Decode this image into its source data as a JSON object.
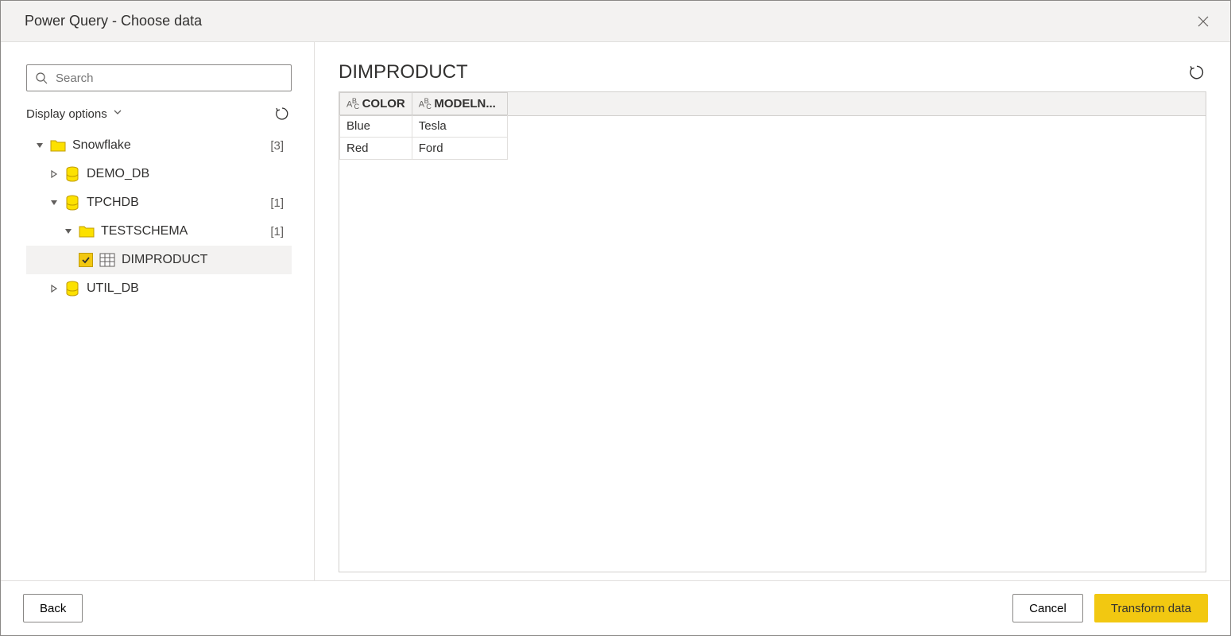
{
  "dialog": {
    "title": "Power Query - Choose data"
  },
  "sidebar": {
    "search_placeholder": "Search",
    "display_options_label": "Display options",
    "tree": {
      "root": {
        "label": "Snowflake",
        "count": "[3]"
      },
      "demo": {
        "label": "DEMO_DB"
      },
      "tpchdb": {
        "label": "TPCHDB",
        "count": "[1]"
      },
      "testschema": {
        "label": "TESTSCHEMA",
        "count": "[1]"
      },
      "dimproduct": {
        "label": "DIMPRODUCT"
      },
      "utildb": {
        "label": "UTIL_DB"
      }
    }
  },
  "main": {
    "title": "DIMPRODUCT",
    "columns": {
      "col1": {
        "type": "ABC",
        "name": "COLOR"
      },
      "col2": {
        "type": "ABC",
        "name": "MODELN..."
      }
    },
    "rows": {
      "r1c1": "Blue",
      "r1c2": "Tesla",
      "r2c1": "Red",
      "r2c2": "Ford"
    }
  },
  "footer": {
    "back": "Back",
    "cancel": "Cancel",
    "transform": "Transform data"
  }
}
